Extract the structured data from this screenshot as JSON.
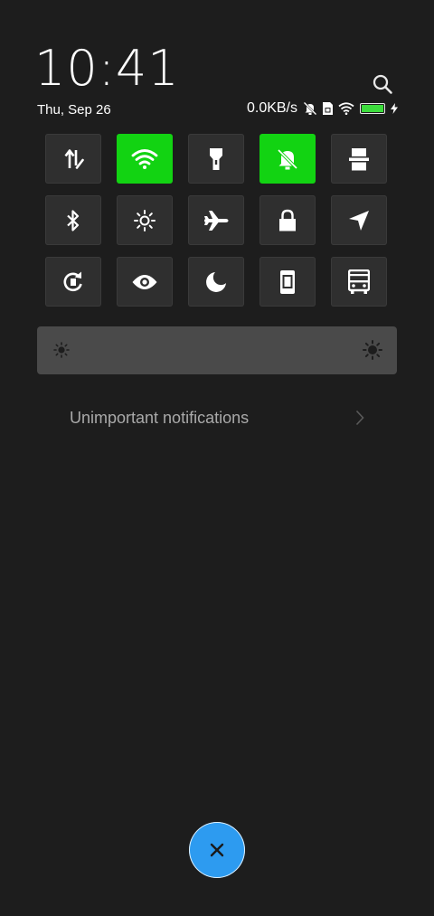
{
  "header": {
    "time": "10:41",
    "date": "Thu, Sep 26",
    "search_icon": "search-icon"
  },
  "status": {
    "net_speed": "0.0KB/s",
    "icons": [
      "mute-icon",
      "sim-icon",
      "wifi-icon",
      "battery-icon",
      "charging-icon"
    ],
    "battery_level": 1.0,
    "battery_color": "#3ddc3d"
  },
  "toggles": [
    {
      "name": "mobile-data",
      "icon": "data-arrows-icon",
      "on": false
    },
    {
      "name": "wifi",
      "icon": "wifi-icon",
      "on": true
    },
    {
      "name": "flashlight",
      "icon": "flashlight-icon",
      "on": false
    },
    {
      "name": "mute",
      "icon": "bell-off-icon",
      "on": true
    },
    {
      "name": "screenshot",
      "icon": "stamp-icon",
      "on": false
    },
    {
      "name": "bluetooth",
      "icon": "bluetooth-icon",
      "on": false
    },
    {
      "name": "auto-brightness",
      "icon": "sun-icon",
      "on": false
    },
    {
      "name": "airplane-mode",
      "icon": "airplane-icon",
      "on": false
    },
    {
      "name": "lock-screen",
      "icon": "lock-icon",
      "on": false
    },
    {
      "name": "location",
      "icon": "navigation-icon",
      "on": false
    },
    {
      "name": "rotation-lock",
      "icon": "rotate-lock-icon",
      "on": false
    },
    {
      "name": "reading-mode",
      "icon": "eye-icon",
      "on": false
    },
    {
      "name": "dark-mode",
      "icon": "moon-icon",
      "on": false
    },
    {
      "name": "screen-cast",
      "icon": "phone-icon",
      "on": false
    },
    {
      "name": "transit-card",
      "icon": "bus-icon",
      "on": false
    }
  ],
  "colors": {
    "background": "#1d1d1d",
    "tile_off": "#2f2f2f",
    "tile_on": "#12d312",
    "fab": "#2d9bf0"
  },
  "brightness": {
    "low_icon": "sun-small-icon",
    "high_icon": "sun-large-icon"
  },
  "notifications": {
    "unimportant_label": "Unimportant notifications"
  },
  "fab": {
    "icon": "close-icon"
  }
}
